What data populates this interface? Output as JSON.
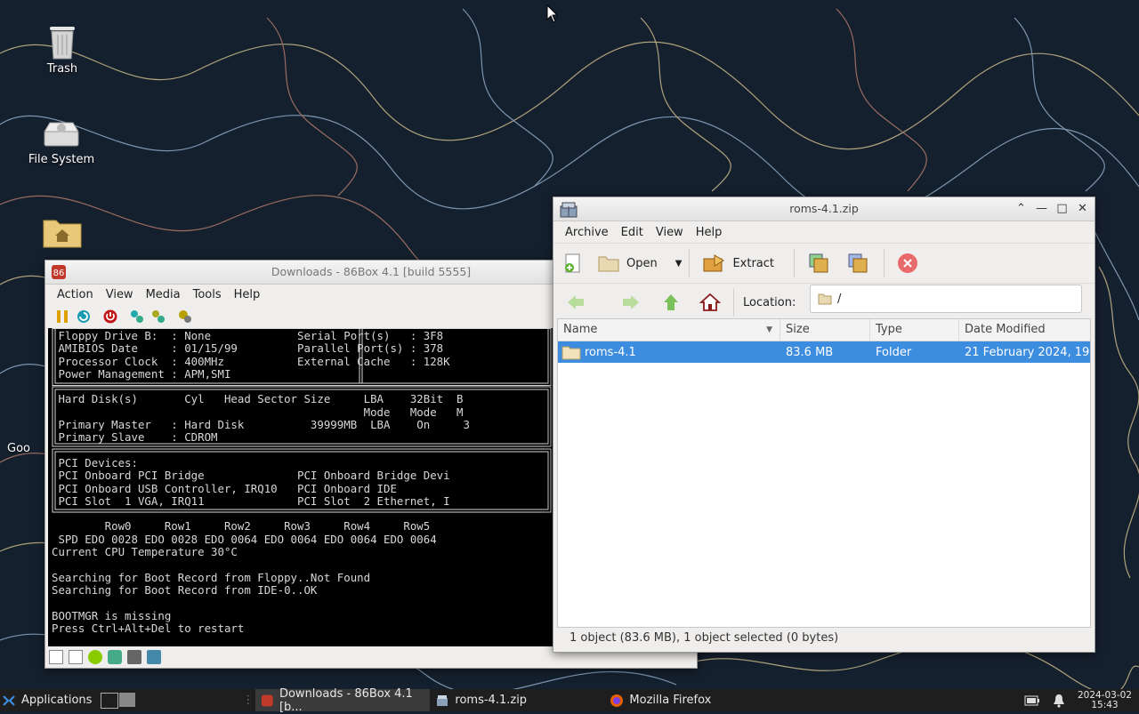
{
  "desktop": {
    "icons": [
      {
        "label": "Trash",
        "icon": "trash-icon"
      },
      {
        "label": "File System",
        "icon": "drive-icon"
      },
      {
        "label": "Home",
        "icon": "home-folder-icon"
      },
      {
        "label": "Goo",
        "icon": "shortcut-icon"
      }
    ]
  },
  "box86": {
    "title": "Downloads - 86Box 4.1 [build 5555]",
    "menu": [
      "Action",
      "View",
      "Media",
      "Tools",
      "Help"
    ],
    "screen_lines": [
      " Floppy Drive B:  : None             Serial Port(s)   : 3F8",
      " AMIBIOS Date     : 01/15/99         Parallel Port(s) : 378",
      " Processor Clock  : 400MHz           External Cache   : 128K",
      " Power Management : APM,SMI",
      "",
      " Hard Disk(s)       Cyl   Head Sector Size     LBA    32Bit  B",
      "                                               Mode   Mode   M",
      " Primary Master   : Hard Disk          39999MB  LBA    On     3",
      " Primary Slave    : CDROM",
      "",
      " PCI Devices:",
      " PCI Onboard PCI Bridge              PCI Onboard Bridge Devi",
      " PCI Onboard USB Controller, IRQ10   PCI Onboard IDE",
      " PCI Slot  1 VGA, IRQ11              PCI Slot  2 Ethernet, I",
      "",
      "        Row0     Row1     Row2     Row3     Row4     Row5",
      " SPD EDO 0028 EDO 0028 EDO 0064 EDO 0064 EDO 0064 EDO 0064",
      "Current CPU Temperature 30°C",
      "",
      "Searching for Boot Record from Floppy..Not Found",
      "Searching for Boot Record from IDE-0..OK",
      "",
      "BOOTMGR is missing",
      "Press Ctrl+Alt+Del to restart"
    ]
  },
  "archive": {
    "title": "roms-4.1.zip",
    "menu": [
      "Archive",
      "Edit",
      "View",
      "Help"
    ],
    "toolbar": {
      "open": "Open",
      "extract": "Extract"
    },
    "location_label": "Location:",
    "location_value": "/",
    "columns": [
      "Name",
      "Size",
      "Type",
      "Date Modified"
    ],
    "rows": [
      {
        "name": "roms-4.1",
        "size": "83.6 MB",
        "type": "Folder",
        "date": "21 February 2024, 19..."
      }
    ],
    "status": "1 object (83.6 MB), 1 object selected (0 bytes)"
  },
  "taskbar": {
    "applications": "Applications",
    "tasks": [
      {
        "label": "Downloads - 86Box 4.1 [b...",
        "icon": "86box-icon"
      },
      {
        "label": "roms-4.1.zip",
        "icon": "archive-icon"
      },
      {
        "label": "Mozilla Firefox",
        "icon": "firefox-icon"
      }
    ],
    "date": "2024-03-02",
    "time": "15:43"
  }
}
